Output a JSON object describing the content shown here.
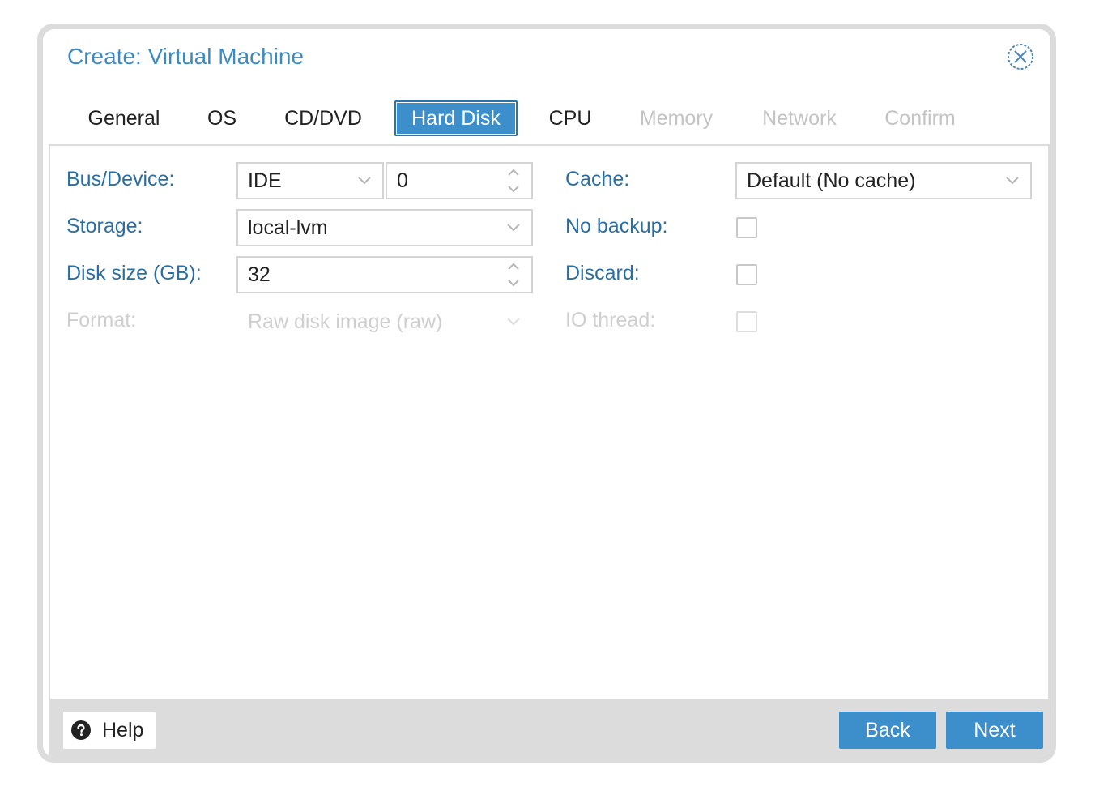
{
  "dialog": {
    "title": "Create: Virtual Machine",
    "close_icon": "close-circle-icon"
  },
  "tabs": [
    {
      "label": "General",
      "state": "enabled"
    },
    {
      "label": "OS",
      "state": "enabled"
    },
    {
      "label": "CD/DVD",
      "state": "enabled"
    },
    {
      "label": "Hard Disk",
      "state": "active"
    },
    {
      "label": "CPU",
      "state": "enabled"
    },
    {
      "label": "Memory",
      "state": "disabled"
    },
    {
      "label": "Network",
      "state": "disabled"
    },
    {
      "label": "Confirm",
      "state": "disabled"
    }
  ],
  "form": {
    "bus_device": {
      "label": "Bus/Device:",
      "bus_value": "IDE",
      "device_value": "0"
    },
    "storage": {
      "label": "Storage:",
      "value": "local-lvm"
    },
    "disk_size": {
      "label": "Disk size (GB):",
      "value": "32"
    },
    "format": {
      "label": "Format:",
      "value": "Raw disk image (raw)",
      "disabled": true
    },
    "cache": {
      "label": "Cache:",
      "value": "Default (No cache)"
    },
    "no_backup": {
      "label": "No backup:",
      "checked": false
    },
    "discard": {
      "label": "Discard:",
      "checked": false
    },
    "io_thread": {
      "label": "IO thread:",
      "checked": false,
      "disabled": true
    }
  },
  "footer": {
    "help_label": "Help",
    "help_icon": "question-circle-icon",
    "back_label": "Back",
    "next_label": "Next"
  },
  "colors": {
    "accent": "#3d8fcc",
    "title": "#3b8bc4",
    "label": "#2a6fa4",
    "disabled": "#c4c4c4"
  }
}
